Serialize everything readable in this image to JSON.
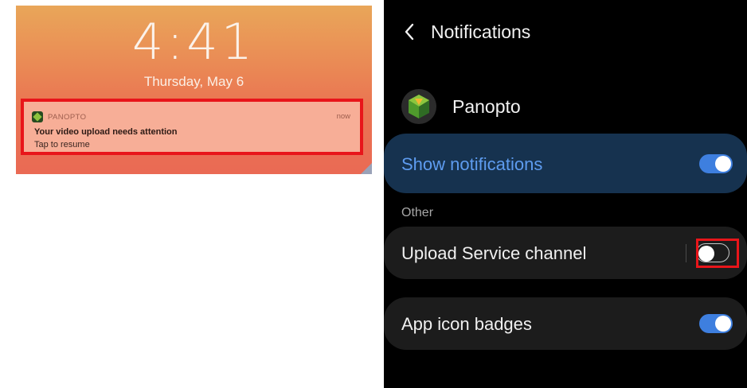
{
  "lock_screen": {
    "time": "4:41",
    "date": "Thursday, May 6",
    "notification": {
      "app_name": "PANOPTO",
      "time": "now",
      "title": "Your video upload needs attention",
      "body": "Tap to resume",
      "app_icon": "panopto-logo-icon"
    }
  },
  "settings": {
    "back_icon": "back-chevron-icon",
    "title": "Notifications",
    "app_name": "Panopto",
    "app_icon": "panopto-logo-icon",
    "show_notifications": {
      "label": "Show notifications",
      "enabled": true
    },
    "section_label": "Other",
    "channels": [
      {
        "label": "Upload Service channel",
        "enabled": false,
        "highlighted": true
      },
      {
        "label": "App icon badges",
        "enabled": true
      }
    ],
    "colors": {
      "accent_blue": "#3e7fdf",
      "highlight_red": "#e8151a",
      "selected_row_bg": "#16324f",
      "show_label_blue": "#5e9cf0"
    }
  }
}
